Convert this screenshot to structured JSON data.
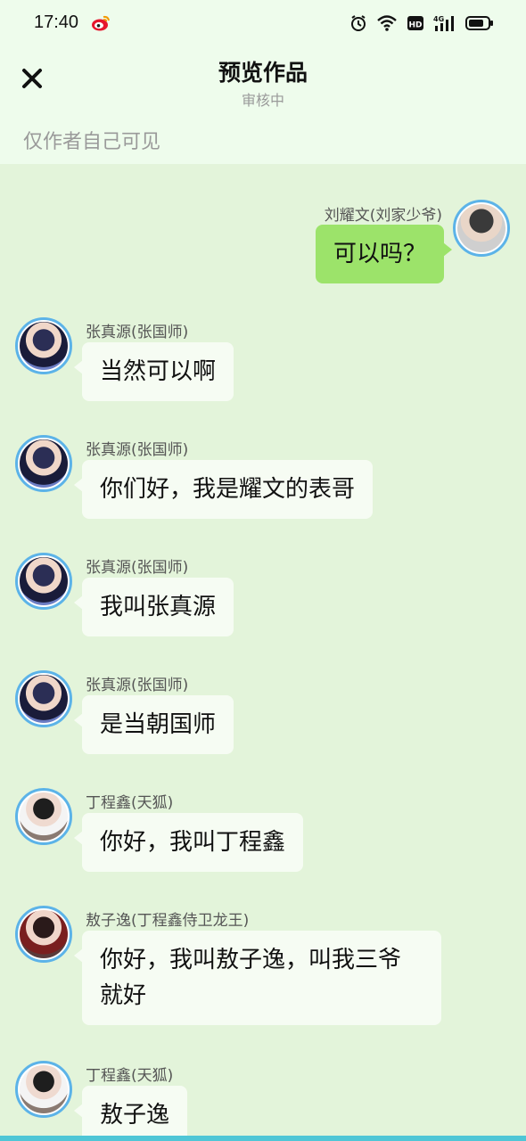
{
  "status_bar": {
    "time": "17:40",
    "icons": [
      "weibo-icon",
      "alarm-icon",
      "wifi-icon",
      "hd-icon",
      "signal-4g-icon",
      "battery-icon"
    ]
  },
  "header": {
    "title": "预览作品",
    "subtitle": "审核中",
    "visibility_note": "仅作者自己可见"
  },
  "messages": [
    {
      "side": "right",
      "name": "刘耀文(刘家少爷)",
      "text": "可以吗？",
      "avatar": "av-liu"
    },
    {
      "side": "left",
      "name": "张真源(张国师)",
      "text": "当然可以啊",
      "avatar": "av-zhang"
    },
    {
      "side": "left",
      "name": "张真源(张国师)",
      "text": "你们好，我是耀文的表哥",
      "avatar": "av-zhang"
    },
    {
      "side": "left",
      "name": "张真源(张国师)",
      "text": "我叫张真源",
      "avatar": "av-zhang"
    },
    {
      "side": "left",
      "name": "张真源(张国师)",
      "text": "是当朝国师",
      "avatar": "av-zhang"
    },
    {
      "side": "left",
      "name": "丁程鑫(天狐)",
      "text": "你好，我叫丁程鑫",
      "avatar": "av-ding"
    },
    {
      "side": "left",
      "name": "敖子逸(丁程鑫侍卫龙王)",
      "text": "你好，我叫敖子逸，叫我三爷就好",
      "avatar": "av-ao"
    },
    {
      "side": "left",
      "name": "丁程鑫(天狐)",
      "text": "敖子逸",
      "avatar": "av-ding"
    }
  ],
  "colors": {
    "chat_background": "#e3f4da",
    "header_background": "#eefcec",
    "own_bubble": "#9ce36a",
    "other_bubble": "#f6fcf3",
    "avatar_ring": "#5cb3e8",
    "bottom_bar": "#4fc6d6"
  }
}
